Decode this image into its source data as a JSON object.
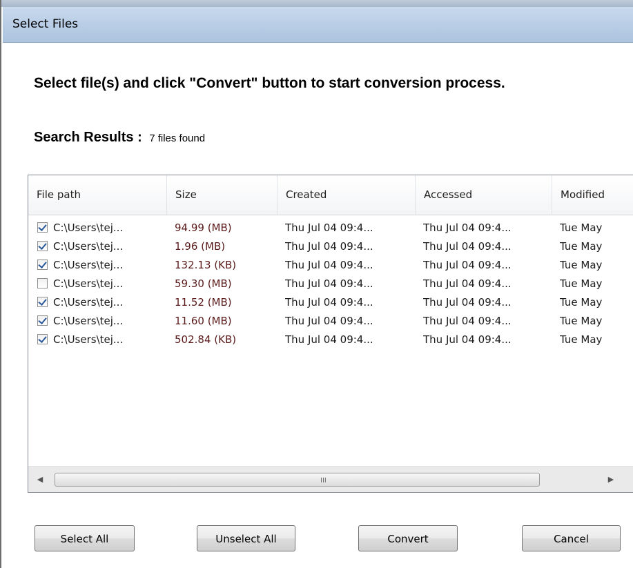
{
  "window": {
    "title": "Select Files"
  },
  "heading": "Select file(s) and click \"Convert\" button to start conversion process.",
  "search": {
    "label": "Search Results :",
    "count": "7 files found"
  },
  "columns": [
    "File path",
    "Size",
    "Created",
    "Accessed",
    "Modified"
  ],
  "rows": [
    {
      "checked": true,
      "path": "C:\\Users\\tej...",
      "size": "94.99 (MB)",
      "created": "Thu Jul 04 09:4...",
      "accessed": "Thu Jul 04 09:4...",
      "modified": "Tue May"
    },
    {
      "checked": true,
      "path": "C:\\Users\\tej...",
      "size": "1.96 (MB)",
      "created": "Thu Jul 04 09:4...",
      "accessed": "Thu Jul 04 09:4...",
      "modified": "Tue May"
    },
    {
      "checked": true,
      "path": "C:\\Users\\tej...",
      "size": "132.13 (KB)",
      "created": "Thu Jul 04 09:4...",
      "accessed": "Thu Jul 04 09:4...",
      "modified": "Tue May"
    },
    {
      "checked": false,
      "path": "C:\\Users\\tej...",
      "size": "59.30 (MB)",
      "created": "Thu Jul 04 09:4...",
      "accessed": "Thu Jul 04 09:4...",
      "modified": "Tue May"
    },
    {
      "checked": true,
      "path": "C:\\Users\\tej...",
      "size": "11.52 (MB)",
      "created": "Thu Jul 04 09:4...",
      "accessed": "Thu Jul 04 09:4...",
      "modified": "Tue May"
    },
    {
      "checked": true,
      "path": "C:\\Users\\tej...",
      "size": "11.60 (MB)",
      "created": "Thu Jul 04 09:4...",
      "accessed": "Thu Jul 04 09:4...",
      "modified": "Tue May"
    },
    {
      "checked": true,
      "path": "C:\\Users\\tej...",
      "size": "502.84 (KB)",
      "created": "Thu Jul 04 09:4...",
      "accessed": "Thu Jul 04 09:4...",
      "modified": "Tue May"
    }
  ],
  "scrollbar": {
    "left_arrow": "◀",
    "right_arrow": "▶",
    "grip": "III"
  },
  "buttons": {
    "select_all": "Select All",
    "unselect_all": "Unselect All",
    "convert": "Convert",
    "cancel": "Cancel"
  }
}
